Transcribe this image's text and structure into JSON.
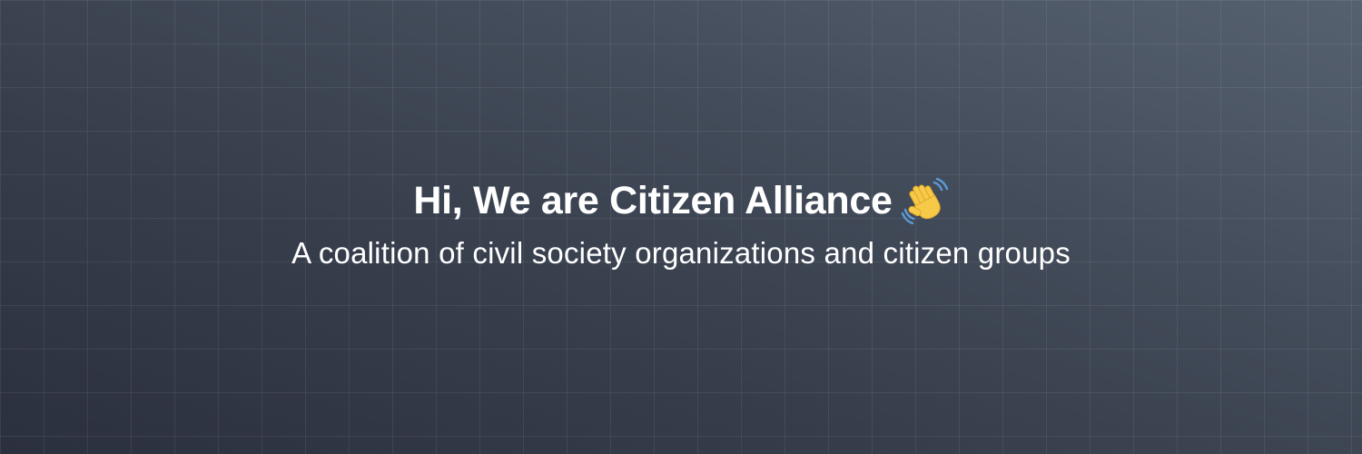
{
  "banner": {
    "headline": "Hi, We are Citizen Alliance",
    "tagline": "A coalition of civil society organizations and citizen groups",
    "icon": "waving-hand-icon"
  },
  "colors": {
    "background_top": "#566170",
    "background_bottom": "#2b303e",
    "text": "#ffffff",
    "wave_hand": "#f7c948",
    "wave_lines": "#5b9bd5"
  }
}
